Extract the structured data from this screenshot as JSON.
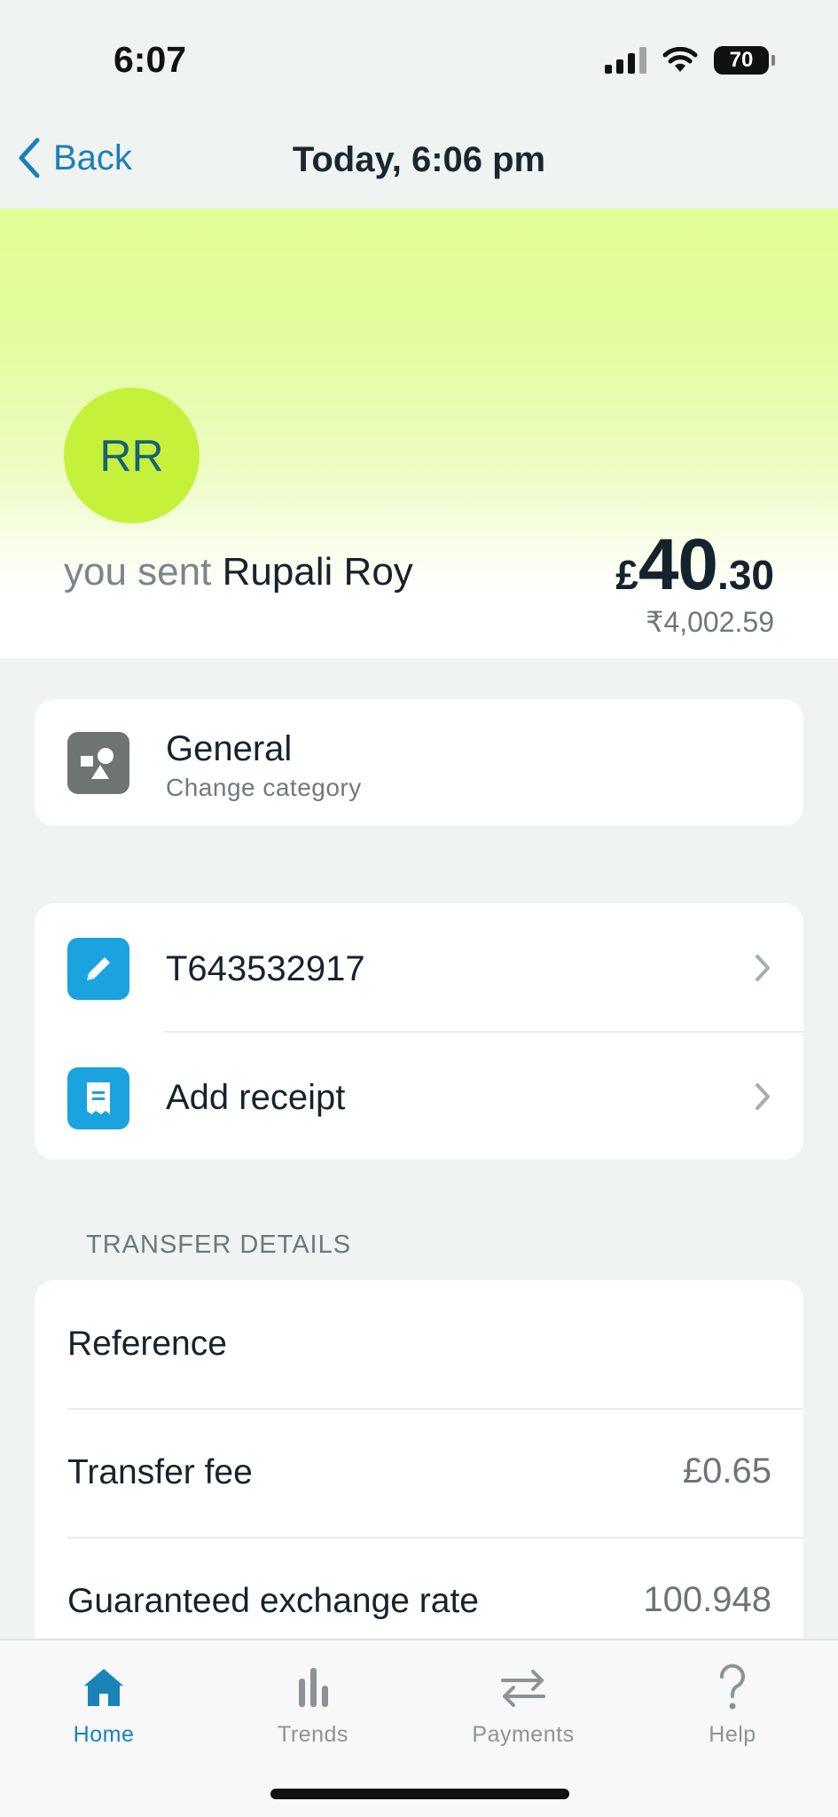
{
  "status_bar": {
    "time": "6:07",
    "battery": "70"
  },
  "nav": {
    "back_label": "Back",
    "title": "Today, 6:06 pm"
  },
  "hero": {
    "initials": "RR",
    "sent_prefix": "you sent",
    "recipient": "Rupali Roy",
    "amount_currency": "£",
    "amount_whole": "40",
    "amount_decimal": ".30",
    "converted_amount": "₹4,002.59"
  },
  "category": {
    "title": "General",
    "subtitle": "Change category"
  },
  "actions": [
    {
      "label": "T643532917",
      "icon": "pencil-icon"
    },
    {
      "label": "Add receipt",
      "icon": "receipt-icon"
    }
  ],
  "transfer_details": {
    "heading": "TRANSFER DETAILS",
    "rows": [
      {
        "label": "Reference",
        "value": ""
      },
      {
        "label": "Transfer fee",
        "value": "£0.65"
      },
      {
        "label": "Guaranteed exchange rate",
        "value": "100.948"
      }
    ]
  },
  "tabs": [
    {
      "label": "Home",
      "icon": "home-icon",
      "active": true
    },
    {
      "label": "Trends",
      "icon": "bar-chart-icon",
      "active": false
    },
    {
      "label": "Payments",
      "icon": "transfer-arrows-icon",
      "active": false
    },
    {
      "label": "Help",
      "icon": "question-icon",
      "active": false
    }
  ],
  "colors": {
    "accent": "#1b83b8",
    "hero_green": "#e1fd96",
    "avatar_green": "#c6f13b",
    "tile_blue": "#1aa3de",
    "tile_grey": "#6d7472"
  }
}
